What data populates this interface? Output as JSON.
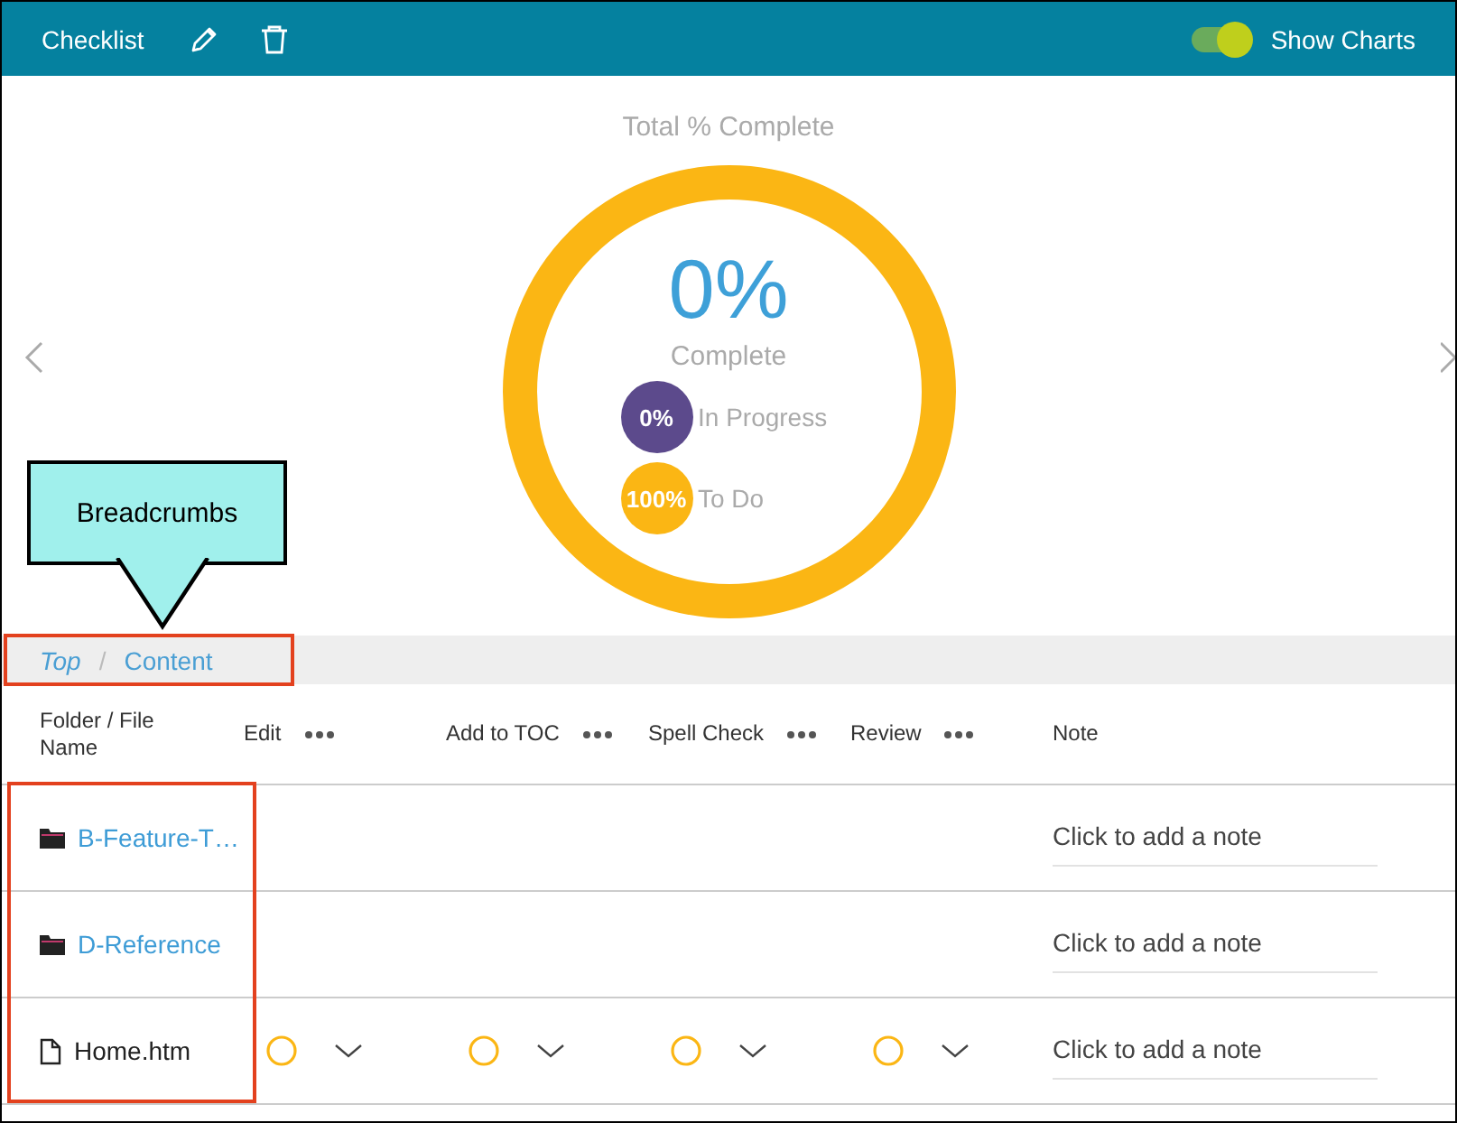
{
  "toolbar": {
    "title": "Checklist",
    "show_charts": {
      "label": "Show Charts",
      "on": true
    }
  },
  "chart": {
    "title": "Total % Complete",
    "percent": "0%",
    "caption": "Complete",
    "legend": [
      {
        "value": "0%",
        "label": "In Progress",
        "color": "#5c4a8c"
      },
      {
        "value": "100%",
        "label": "To Do",
        "color": "#fbb614"
      }
    ]
  },
  "callout": {
    "text": "Breadcrumbs"
  },
  "breadcrumbs": [
    {
      "label": "Top",
      "kind": "root"
    },
    {
      "label": "Content",
      "kind": "current"
    }
  ],
  "breadcrumb_separator": "/",
  "table": {
    "columns": [
      {
        "label": "Folder / File Name",
        "kind": "name"
      },
      {
        "label": "Edit",
        "kind": "status"
      },
      {
        "label": "Add to TOC",
        "kind": "status"
      },
      {
        "label": "Spell Check",
        "kind": "status"
      },
      {
        "label": "Review",
        "kind": "status"
      },
      {
        "label": "Note",
        "kind": "note"
      }
    ],
    "rows": [
      {
        "name": "B-Feature-T…",
        "kind": "folder",
        "note_placeholder": "Click to add a note"
      },
      {
        "name": "D-Reference",
        "kind": "folder",
        "note_placeholder": "Click to add a note"
      },
      {
        "name": "Home.htm",
        "kind": "file",
        "note_placeholder": "Click to add a note"
      }
    ]
  }
}
